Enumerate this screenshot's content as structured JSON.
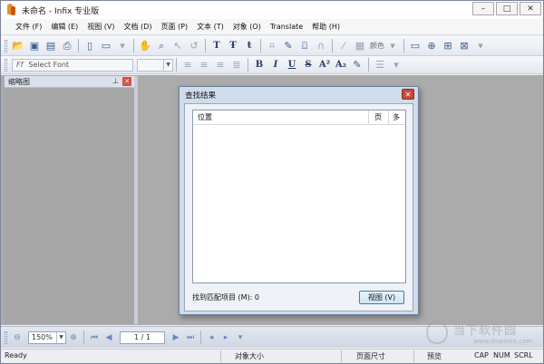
{
  "window": {
    "title": "未命名 - Infix 专业版"
  },
  "menu": [
    "文件 (F)",
    "编辑 (E)",
    "视图 (V)",
    "文档 (D)",
    "页面 (P)",
    "文本 (T)",
    "对象 (O)",
    "Translate",
    "帮助 (H)"
  ],
  "toolbar2": {
    "font_placeholder": "Select Font",
    "font_glyph": "Ff",
    "color_label": "颜色"
  },
  "panel": {
    "title": "缩略图"
  },
  "dialog": {
    "title": "查找结果",
    "col_position": "位置",
    "col_page": "页",
    "col_extra": "多",
    "found_label": "找到匹配项目 (M): 0",
    "view_button": "视图 (V)"
  },
  "nav": {
    "zoom": "150%",
    "page": "1 / 1"
  },
  "status": {
    "ready": "Ready",
    "object_size": "对象大小",
    "page_size": "页面尺寸",
    "preview": "预览",
    "cap": "CAP",
    "num": "NUM",
    "scrl": "SCRL"
  },
  "watermark": {
    "text": "当下软件园",
    "url": "www.downxia.com"
  },
  "colors": {
    "dialog_bg": "#cfdcec",
    "close_red": "#c94a3a",
    "workspace": "#ababab",
    "toolbar_blue": "#3b5d8f"
  }
}
